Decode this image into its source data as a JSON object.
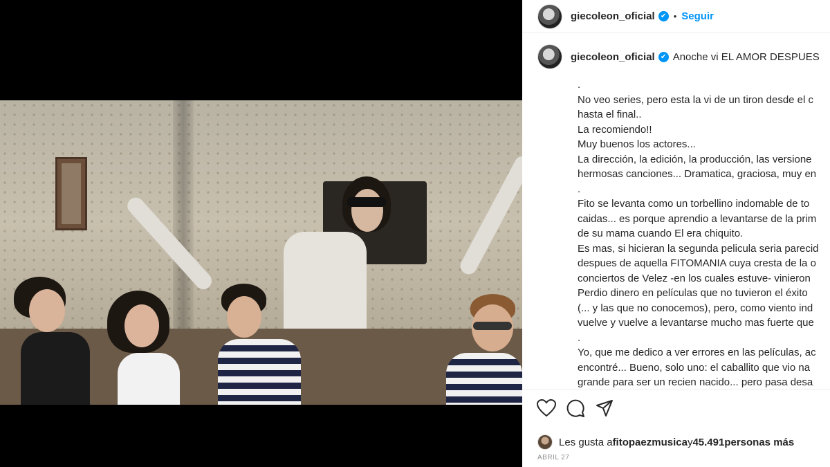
{
  "post": {
    "username": "giecoleon_oficial",
    "follow_label": "Seguir",
    "separator": "•",
    "verified_icon": "✔"
  },
  "caption": {
    "username": "giecoleon_oficial",
    "first_line": "Anoche vi EL AMOR DESPUES",
    "lines": [
      ".",
      "No veo series, pero esta la vi de un tiron desde el c",
      "hasta el final..",
      "La recomiendo!!",
      "Muy buenos los actores...",
      "La dirección, la edición, la producción, las versione",
      "hermosas canciones... Dramatica, graciosa, muy en",
      ".",
      "Fito se levanta como un torbellino indomable de to",
      "caidas... es porque aprendio a levantarse de la prim",
      "de su mama cuando El era chiquito.",
      "Es mas, si hicieran la segunda pelicula seria parecid",
      "despues de aquella FITOMANIA cuya cresta de la o",
      "conciertos de Velez -en los cuales estuve- vinieron",
      "Perdio dinero en películas que no tuvieron el éxito",
      "(... y las que no conocemos), pero, como viento ind",
      "vuelve y vuelve a levantarse mucho mas fuerte que",
      ".",
      "Yo, que me dedico a ver errores en las películas, ac",
      "encontré... Bueno, solo uno: el caballito que vio na",
      "grande para ser un recien nacido... pero pasa desa"
    ]
  },
  "likes": {
    "prefix": "Les gusta a ",
    "user": "fitopaezmusica",
    "middle": " y ",
    "count": "45.491",
    "suffix": " personas más"
  },
  "date": "ABRIL 27",
  "colors": {
    "accent": "#0095f6",
    "text": "#262626",
    "muted": "#8e8e8e"
  }
}
